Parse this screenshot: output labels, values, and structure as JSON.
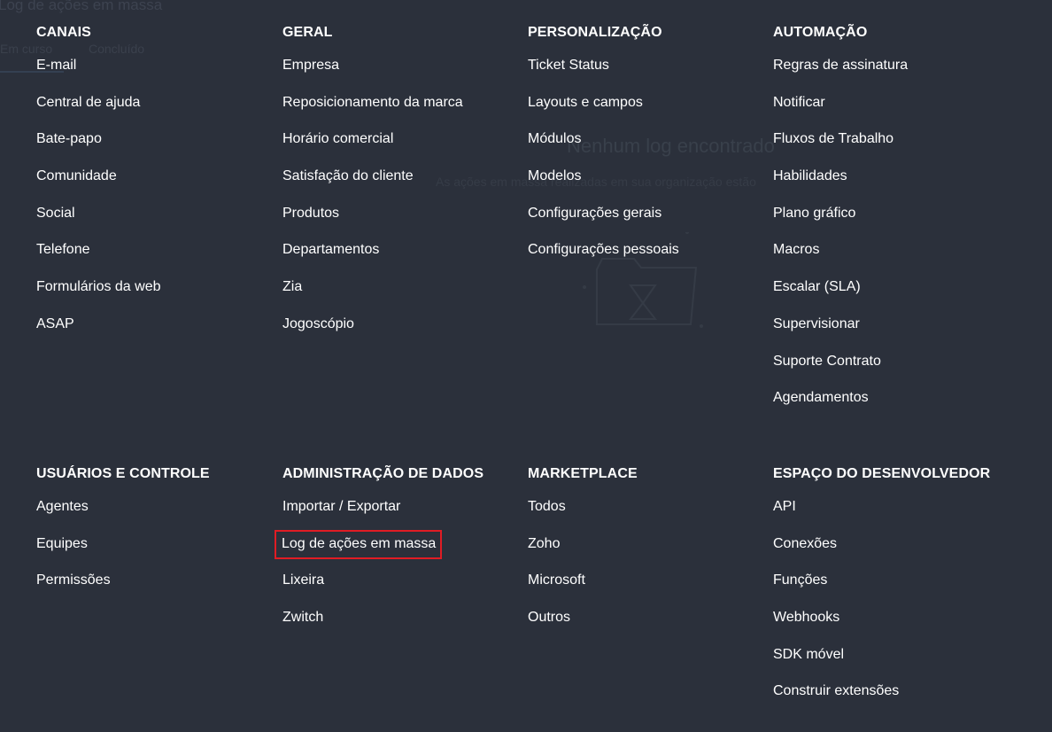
{
  "background": {
    "page_title": "Log de ações em massa",
    "tabs": [
      "Em curso",
      "Concluído"
    ],
    "empty_state_title": "Nenhum log encontrado",
    "empty_state_text": "As ações em massa realizadas em sua organização estão"
  },
  "menu": {
    "sections": [
      {
        "title": "CANAIS",
        "items": [
          "E-mail",
          "Central de ajuda",
          "Bate-papo",
          "Comunidade",
          "Social",
          "Telefone",
          "Formulários da web",
          "ASAP"
        ]
      },
      {
        "title": "GERAL",
        "items": [
          "Empresa",
          "Reposicionamento da marca",
          "Horário comercial",
          "Satisfação do cliente",
          "Produtos",
          "Departamentos",
          "Zia",
          "Jogoscópio"
        ]
      },
      {
        "title": "PERSONALIZAÇÃO",
        "items": [
          "Ticket Status",
          "Layouts e campos",
          "Módulos",
          "Modelos",
          "Configurações gerais",
          "Configurações pessoais"
        ]
      },
      {
        "title": "AUTOMAÇÃO",
        "items": [
          "Regras de assinatura",
          "Notificar",
          "Fluxos de Trabalho",
          "Habilidades",
          "Plano gráfico",
          "Macros",
          "Escalar (SLA)",
          "Supervisionar",
          "Suporte Contrato",
          "Agendamentos"
        ]
      },
      {
        "title": "USUÁRIOS E CONTROLE",
        "items": [
          "Agentes",
          "Equipes",
          "Permissões"
        ]
      },
      {
        "title": "ADMINISTRAÇÃO DE DADOS",
        "items": [
          "Importar / Exportar",
          "Log de ações em massa",
          "Lixeira",
          "Zwitch"
        ]
      },
      {
        "title": "MARKETPLACE",
        "items": [
          "Todos",
          "Zoho",
          "Microsoft",
          "Outros"
        ]
      },
      {
        "title": "ESPAÇO DO DESENVOLVEDOR",
        "items": [
          "API",
          "Conexões",
          "Funções",
          "Webhooks",
          "SDK móvel",
          "Construir extensões"
        ]
      }
    ],
    "highlighted_item": "Log de ações em massa"
  },
  "colors": {
    "background": "#2b303b",
    "text": "#ffffff",
    "highlight_border": "#e01c24"
  }
}
